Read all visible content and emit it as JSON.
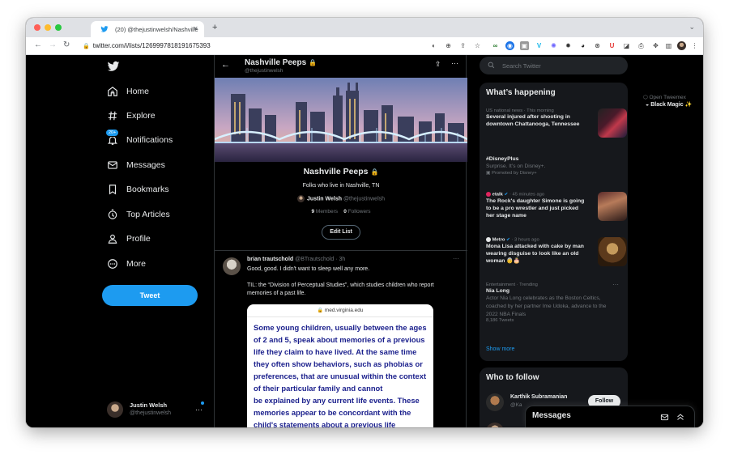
{
  "browser": {
    "tab_title": "(20) @thejustinwelsh/Nashville",
    "url": "twitter.com/i/lists/1269997818191675393",
    "new_tab": "+",
    "overlay": {
      "tweemex": "Open Tweemex",
      "black_magic": "Black Magic ✨"
    }
  },
  "nav": {
    "items": [
      {
        "label": "Home",
        "icon": "home-icon"
      },
      {
        "label": "Explore",
        "icon": "hashtag-icon"
      },
      {
        "label": "Notifications",
        "icon": "bell-icon",
        "badge": "20+"
      },
      {
        "label": "Messages",
        "icon": "envelope-icon"
      },
      {
        "label": "Bookmarks",
        "icon": "bookmark-icon"
      },
      {
        "label": "Top Articles",
        "icon": "articles-icon"
      },
      {
        "label": "Profile",
        "icon": "person-icon"
      },
      {
        "label": "More",
        "icon": "more-circle-icon"
      }
    ],
    "tweet_button": "Tweet",
    "account": {
      "name": "Justin Welsh",
      "handle": "@thejustinwelsh"
    }
  },
  "list": {
    "title": "Nashville Peeps",
    "handle": "@thejustinwelsh",
    "name": "Nashville Peeps",
    "description": "Folks who live in Nashville, TN",
    "owner_name": "Justin Welsh",
    "owner_handle": "@thejustinwelsh",
    "members_count": "9",
    "members_label": "Members",
    "followers_count": "0",
    "followers_label": "Followers",
    "edit_button": "Edit List"
  },
  "tweet": {
    "author": "brian trautschold",
    "handle": "@BTrautschold",
    "time": "· 3h",
    "line1": "Good, good. I didn't want to sleep well any more.",
    "line2": "TIL: the “Division of Perceptual Studies”, which studies children who report memories of a past life.",
    "card_domain": "med.virginia.edu",
    "card_lines": [
      "Some young children, usually between the ages",
      "of 2 and 5, speak about memories of a previous",
      "life they claim to have lived. At the same time",
      "they often show behaviors, such as phobias or",
      "preferences, that are unusual within the context",
      "of their particular family and cannot",
      "be explained by any current life events. These",
      "memories appear to be concordant with the",
      "child's statements about a previous life"
    ]
  },
  "sidebar": {
    "search_placeholder": "Search Twitter",
    "happening_title": "What’s happening",
    "trends": [
      {
        "meta": "US national news · This morning",
        "title": "Several injured after shooting in downtown Chattanooga, Tennessee"
      },
      {
        "title": "#DisneyPlus",
        "desc": "Surprise. It’s on Disney+.",
        "meta": "Promoted by Disney+"
      },
      {
        "source": "etalk",
        "meta": "· 45 minutes ago",
        "title": "The Rock's daughter Simone is going to be a pro wrestler and just picked her stage name"
      },
      {
        "source": "Metro",
        "meta": "· 3 hours ago",
        "title": "Mona Lisa attacked with cake by man wearing disguise to look like an old woman 👵🎂"
      },
      {
        "meta": "Entertainment · Trending",
        "title": "Nia Long",
        "desc": "Actor Nia Long celebrates as the Boston Celtics, coached by her partner Ime Udoka, advance to the 2022 NBA Finals",
        "count": "8,186 Tweets"
      }
    ],
    "show_more": "Show more",
    "follow_title": "Who to follow",
    "follow": {
      "name": "Karthik Subramanian",
      "handle": "@Ka",
      "button": "Follow"
    },
    "messages_title": "Messages"
  },
  "colors": {
    "accent": "#1d9bf0",
    "background": "#000000",
    "panel": "#16181c"
  }
}
